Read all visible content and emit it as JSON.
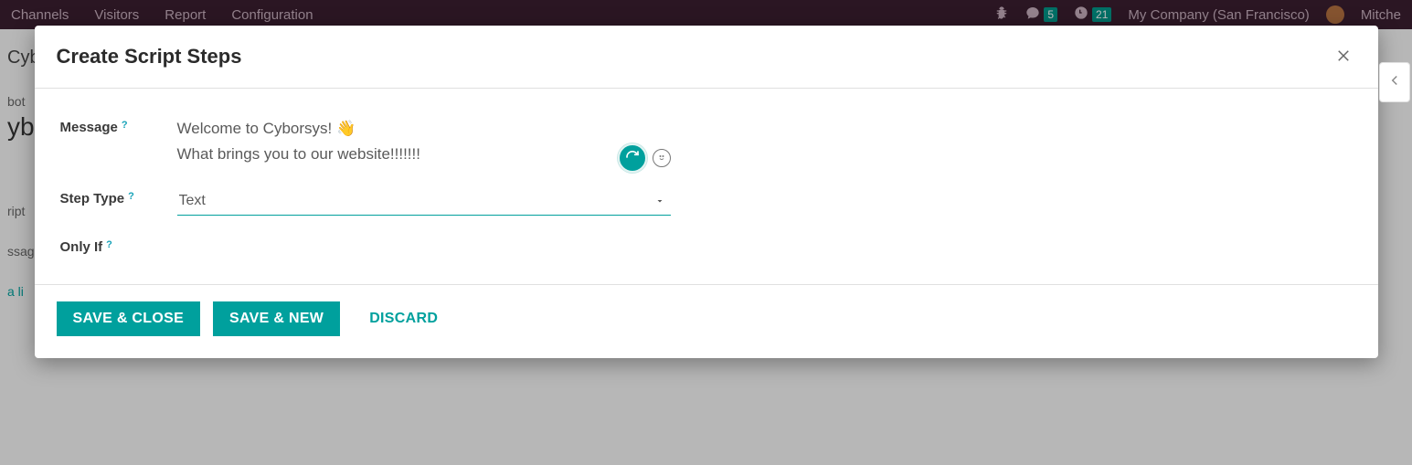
{
  "topbar": {
    "menu": [
      "Channels",
      "Visitors",
      "Report",
      "Configuration"
    ],
    "msg_badge": "5",
    "clock_badge": "21",
    "company": "My Company (San Francisco)",
    "user": "Mitche"
  },
  "bg": {
    "crumb1": "Cyb",
    "crumb2_prefix": "bot",
    "heading": "yb",
    "row1": "ript",
    "row2": "ssag",
    "link": "a li"
  },
  "modal": {
    "title": "Create Script Steps",
    "labels": {
      "message": "Message",
      "step_type": "Step Type",
      "only_if": "Only If"
    },
    "message_value": "Welcome to Cyborsys! 👋\nWhat brings you to our website!!!!!!!",
    "step_type_value": "Text",
    "buttons": {
      "save_close": "SAVE & CLOSE",
      "save_new": "SAVE & NEW",
      "discard": "DISCARD"
    },
    "help_mark": "?"
  }
}
